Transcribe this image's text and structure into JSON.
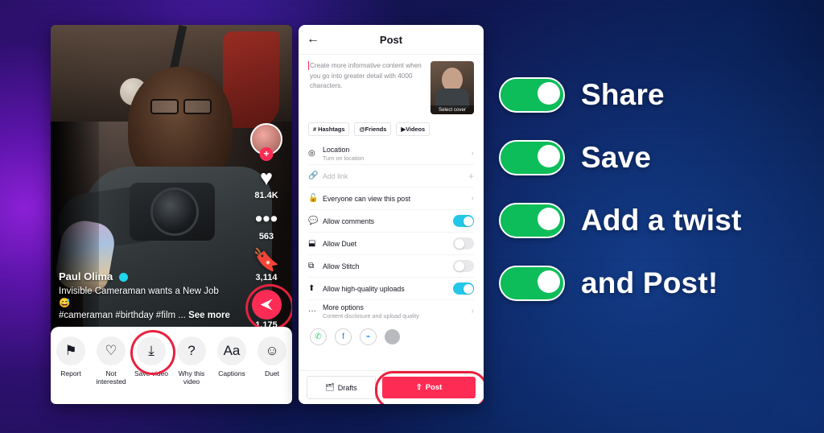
{
  "phone_video": {
    "user_name": "Paul Olima",
    "description": "Invisible Cameraman wants a New Job 😅",
    "hashtags": "#cameraman #birthday #film ...",
    "see_more": "See more",
    "actions": {
      "like_count": "81.4K",
      "comment_count": "563",
      "bookmark_count": "3,114",
      "share_count": "1,175",
      "plus_label": "+"
    },
    "sheet_options": [
      {
        "icon": "flag-icon",
        "glyph": "⚑",
        "label": "Report"
      },
      {
        "icon": "broken-heart-icon",
        "glyph": "♡",
        "label": "Not interested"
      },
      {
        "icon": "download-icon",
        "glyph": "⤓",
        "label": "Save video"
      },
      {
        "icon": "question-icon",
        "glyph": "?",
        "label": "Why this video"
      },
      {
        "icon": "captions-icon",
        "glyph": "Aa",
        "label": "Captions"
      },
      {
        "icon": "duet-icon",
        "glyph": "☺",
        "label": "Duet"
      }
    ]
  },
  "phone_post": {
    "header_title": "Post",
    "back_icon": "←",
    "description_placeholder": "Create more informative content when you go into greater detail with 4000 characters.",
    "cover_label": "Select cover",
    "chips": [
      {
        "icon": "hashtag-icon",
        "label": "Hashtags"
      },
      {
        "icon": "at-icon",
        "label": "Friends"
      },
      {
        "icon": "video-icon",
        "label": "Videos"
      }
    ],
    "rows": [
      {
        "icon": "location-icon",
        "glyph": "◎",
        "label": "Location",
        "sub": "Turn on location",
        "control": "chevron"
      },
      {
        "icon": "link-icon",
        "glyph": "🔗",
        "label": "Add link",
        "control": "plus"
      },
      {
        "icon": "lock-icon",
        "glyph": "🔓",
        "label": "Everyone can view this post",
        "control": "chevron"
      },
      {
        "icon": "comment-icon",
        "glyph": "💬",
        "label": "Allow comments",
        "control": "toggle",
        "state": "on"
      },
      {
        "icon": "duet-icon",
        "glyph": "⬓",
        "label": "Allow Duet",
        "control": "toggle",
        "state": "off"
      },
      {
        "icon": "stitch-icon",
        "glyph": "⧉",
        "label": "Allow Stitch",
        "control": "toggle",
        "state": "off"
      },
      {
        "icon": "upload-quality-icon",
        "glyph": "⬆",
        "label": "Allow high-quality uploads",
        "control": "toggle",
        "state": "on"
      },
      {
        "icon": "more-options-icon",
        "glyph": "···",
        "label": "More options",
        "sub": "Content disclosure and upload quality",
        "control": "chevron"
      }
    ],
    "share_row": [
      {
        "icon": "whatsapp-icon",
        "glyph": "✆"
      },
      {
        "icon": "facebook-icon",
        "glyph": "f"
      },
      {
        "icon": "messenger-icon",
        "glyph": "⌁"
      },
      {
        "icon": "more-share-icon",
        "glyph": ""
      }
    ],
    "footer": {
      "drafts_label": "Drafts",
      "drafts_icon": "🗂",
      "post_label": "Post",
      "post_icon": "⇧"
    }
  },
  "callouts": {
    "accent_green": "#0cbd5a",
    "highlight_red": "#e8213f",
    "items": [
      {
        "label": "Share",
        "state": "on"
      },
      {
        "label": "Save",
        "state": "on"
      },
      {
        "label": "Add a twist",
        "state": "on"
      },
      {
        "label": "and Post!",
        "state": "on"
      }
    ]
  }
}
